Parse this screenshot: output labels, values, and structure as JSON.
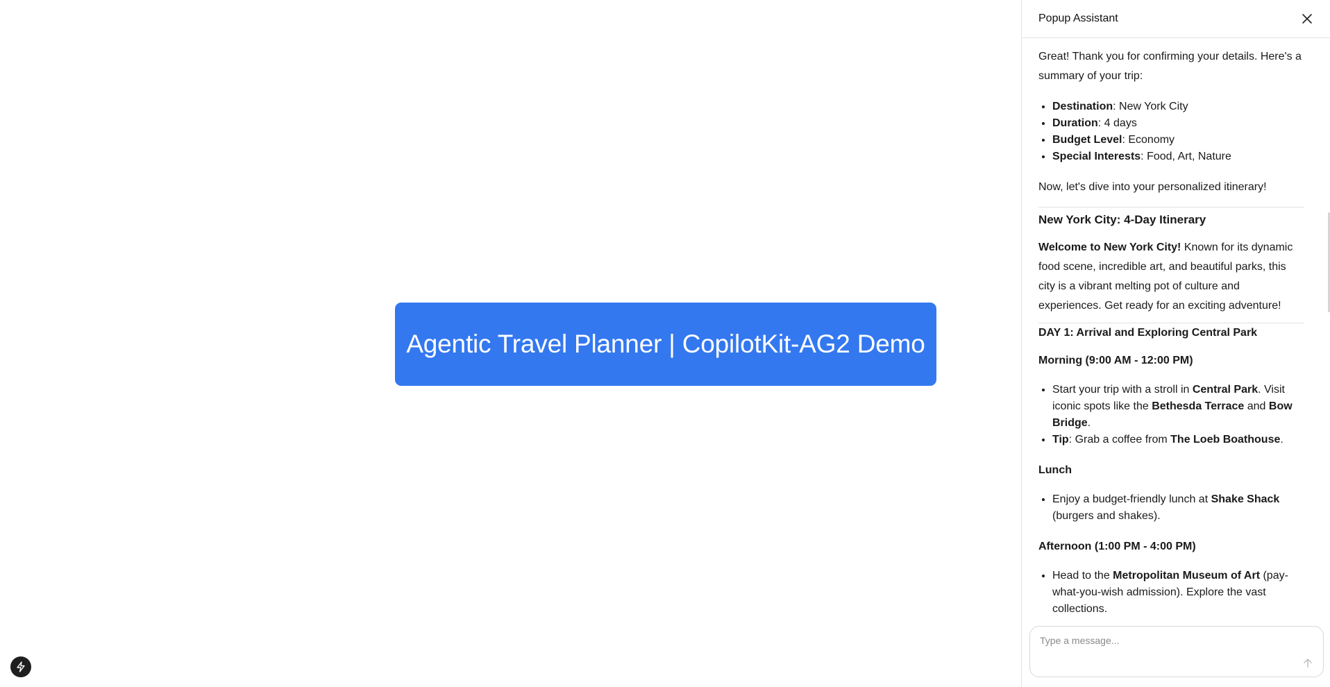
{
  "main": {
    "hero_title": "Agentic Travel Planner | CopilotKit-AG2 Demo",
    "fab_icon": "bolt-icon"
  },
  "panel": {
    "title": "Popup Assistant",
    "close_icon": "close-icon",
    "input_placeholder": "Type a message...",
    "send_icon": "arrow-up-icon"
  },
  "message": {
    "intro": "Great! Thank you for confirming your details. Here's a summary of your trip:",
    "summary": [
      {
        "label": "Destination",
        "value": ": New York City"
      },
      {
        "label": "Duration",
        "value": ": 4 days"
      },
      {
        "label": "Budget Level",
        "value": ": Economy"
      },
      {
        "label": "Special Interests",
        "value": ": Food, Art, Nature"
      }
    ],
    "lead": "Now, let's dive into your personalized itinerary!",
    "itinerary_title": "New York City: 4-Day Itinerary",
    "welcome_bold": "Welcome to New York City!",
    "welcome_text": " Known for its dynamic food scene, incredible art, and beautiful parks, this city is a vibrant melting pot of culture and experiences. Get ready for an exciting adventure!",
    "day1_title": "DAY 1: Arrival and Exploring Central Park",
    "morning_title": "Morning (9:00 AM - 12:00 PM)",
    "morning": {
      "t1": "Start your trip with a stroll in ",
      "b1": "Central Park",
      "t2": ". Visit iconic spots like the ",
      "b2": "Bethesda Terrace",
      "t3": " and ",
      "b3": "Bow Bridge",
      "t4": ".",
      "tip_label": "Tip",
      "tip_t1": ": Grab a coffee from ",
      "tip_b1": "The Loeb Boathouse",
      "tip_t2": "."
    },
    "lunch_title": "Lunch",
    "lunch": {
      "t1": "Enjoy a budget-friendly lunch at ",
      "b1": "Shake Shack",
      "t2": " (burgers and shakes)."
    },
    "afternoon_title": "Afternoon (1:00 PM - 4:00 PM)",
    "afternoon": {
      "t1": "Head to the ",
      "b1": "Metropolitan Museum of Art",
      "t2": " (pay-what-you-wish admission). Explore the vast collections."
    }
  }
}
